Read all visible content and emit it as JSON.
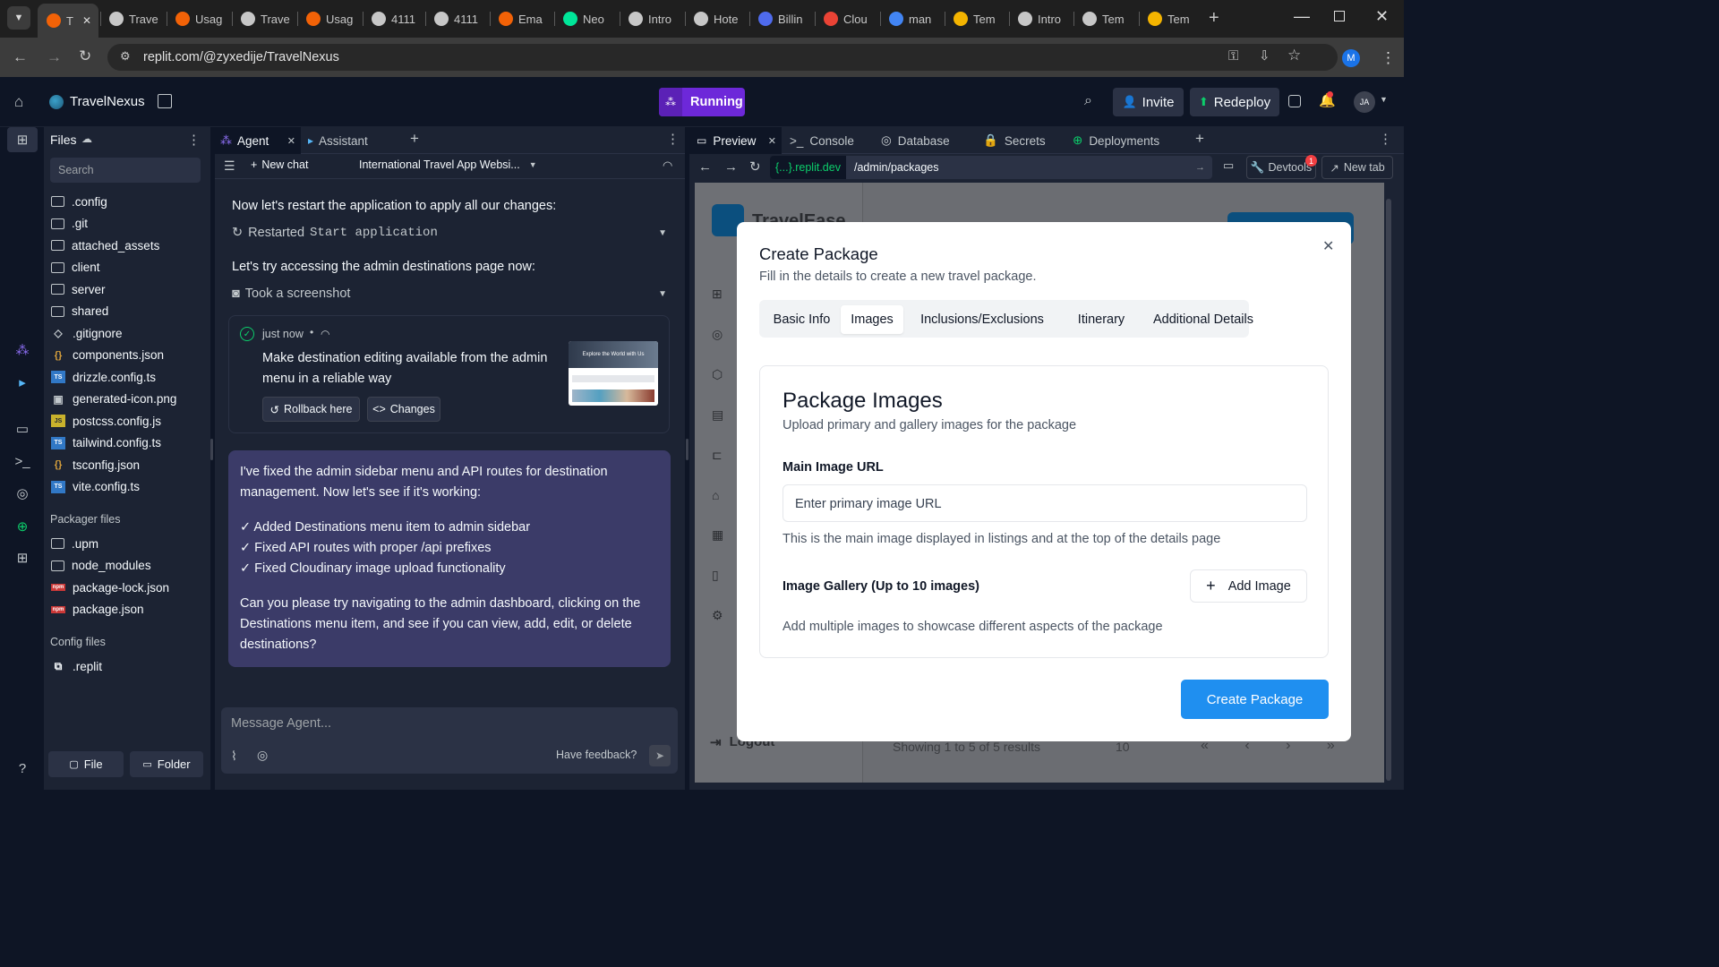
{
  "browser": {
    "tabs": [
      {
        "label": "T",
        "icon": "replit-icon",
        "color": "#f26207"
      },
      {
        "label": "Trave",
        "icon": "globe-icon",
        "color": "#c7c7c7"
      },
      {
        "label": "Usag",
        "icon": "replit-icon",
        "color": "#f26207"
      },
      {
        "label": "Trave",
        "icon": "globe-icon",
        "color": "#c7c7c7"
      },
      {
        "label": "Usag",
        "icon": "replit-icon",
        "color": "#f26207"
      },
      {
        "label": "4111",
        "icon": "globe-icon",
        "color": "#c7c7c7"
      },
      {
        "label": "4111",
        "icon": "globe-icon",
        "color": "#c7c7c7"
      },
      {
        "label": "Ema",
        "icon": "replit-icon",
        "color": "#f26207"
      },
      {
        "label": "Neo",
        "icon": "neon-icon",
        "color": "#00e699"
      },
      {
        "label": "Intro",
        "icon": "openai-icon",
        "color": "#c7c7c7"
      },
      {
        "label": "Hote",
        "icon": "openai-icon",
        "color": "#c7c7c7"
      },
      {
        "label": "Billin",
        "icon": "billing-icon",
        "color": "#4f6bed"
      },
      {
        "label": "Clou",
        "icon": "gmail-icon",
        "color": "#ea4335"
      },
      {
        "label": "man",
        "icon": "google-icon",
        "color": "#4285f4"
      },
      {
        "label": "Tem",
        "icon": "envelope-icon",
        "color": "#f4b400"
      },
      {
        "label": "Intro",
        "icon": "openai-icon",
        "color": "#c7c7c7"
      },
      {
        "label": "Tem",
        "icon": "openai-icon",
        "color": "#c7c7c7"
      },
      {
        "label": "Tem",
        "icon": "envelope-icon",
        "color": "#f4b400"
      }
    ],
    "url": "replit.com/@zyxedije/TravelNexus",
    "profile_initial": "M"
  },
  "replit": {
    "project_name": "TravelNexus",
    "run_status": "Running",
    "invite_label": "Invite",
    "redeploy_label": "Redeploy",
    "avatar_initials": "JA"
  },
  "files": {
    "title": "Files",
    "search_placeholder": "Search",
    "items": [
      {
        "name": ".config",
        "type": "folder"
      },
      {
        "name": ".git",
        "type": "folder"
      },
      {
        "name": "attached_assets",
        "type": "folder"
      },
      {
        "name": "client",
        "type": "folder"
      },
      {
        "name": "server",
        "type": "folder"
      },
      {
        "name": "shared",
        "type": "folder"
      },
      {
        "name": ".gitignore",
        "type": "git"
      },
      {
        "name": "components.json",
        "type": "json"
      },
      {
        "name": "drizzle.config.ts",
        "type": "ts"
      },
      {
        "name": "generated-icon.png",
        "type": "image"
      },
      {
        "name": "postcss.config.js",
        "type": "js"
      },
      {
        "name": "tailwind.config.ts",
        "type": "ts"
      },
      {
        "name": "tsconfig.json",
        "type": "json"
      },
      {
        "name": "vite.config.ts",
        "type": "ts"
      }
    ],
    "packager_title": "Packager files",
    "packager_items": [
      {
        "name": ".upm",
        "type": "folder"
      },
      {
        "name": "node_modules",
        "type": "folder"
      },
      {
        "name": "package-lock.json",
        "type": "npm"
      },
      {
        "name": "package.json",
        "type": "npm"
      }
    ],
    "config_title": "Config files",
    "config_items": [
      {
        "name": ".replit",
        "type": "replit"
      }
    ],
    "file_button": "File",
    "folder_button": "Folder"
  },
  "agent": {
    "tabs": [
      {
        "label": "Agent"
      },
      {
        "label": "Assistant"
      }
    ],
    "new_chat": "New chat",
    "chat_title": "International Travel App Websi...",
    "msg_restart": "Now let's restart the application to apply all our changes:",
    "restarted_label": "Restarted",
    "restarted_code": "Start application",
    "msg_access": "Let's try accessing the admin destinations page now:",
    "screenshot_label": "Took a screenshot",
    "checkpoint": {
      "time": "just now",
      "text": "Make destination editing available from the admin menu in a reliable way",
      "rollback": "Rollback here",
      "changes": "Changes",
      "thumb_text": "Explore the World with Us"
    },
    "reply": {
      "intro": "I've fixed the admin sidebar menu and API routes for destination management. Now let's see if it's working:",
      "bullets": [
        "✓ Added Destinations menu item to admin sidebar",
        "✓ Fixed API routes with proper /api prefixes",
        "✓ Fixed Cloudinary image upload functionality"
      ],
      "outro": "Can you please try navigating to the admin dashboard, clicking on the Destinations menu item, and see if you can view, add, edit, or delete destinations?"
    },
    "input_placeholder": "Message Agent...",
    "feedback": "Have feedback?"
  },
  "preview": {
    "tabs": [
      {
        "label": "Preview"
      },
      {
        "label": "Console"
      },
      {
        "label": "Database"
      },
      {
        "label": "Secrets"
      },
      {
        "label": "Deployments"
      }
    ],
    "domain": "{...}.replit.dev",
    "path": "/admin/packages",
    "devtools": "Devtools",
    "devtools_badge": "1",
    "new_tab": "New tab",
    "bg_logo": "TravelEase",
    "bg_logout": "Logout",
    "bg_showing": "Showing 1 to 5 of 5 results",
    "bg_per_page": "10",
    "bg_pager": "«  ‹  ›  »"
  },
  "modal": {
    "title": "Create Package",
    "subtitle": "Fill in the details to create a new travel package.",
    "tabs": [
      {
        "label": "Basic Info"
      },
      {
        "label": "Images"
      },
      {
        "label": "Inclusions/Exclusions"
      },
      {
        "label": "Itinerary"
      },
      {
        "label": "Additional Details"
      }
    ],
    "selected_tab": "Images",
    "section_title": "Package Images",
    "section_subtitle": "Upload primary and gallery images for the package",
    "main_label": "Main Image URL",
    "main_placeholder": "Enter primary image URL",
    "main_help": "This is the main image displayed in listings and at the top of the details page",
    "gallery_label": "Image Gallery (Up to 10 images)",
    "add_image": "Add Image",
    "gallery_help": "Add multiple images to showcase different aspects of the package",
    "submit": "Create Package"
  },
  "colors": {
    "replit_bg": "#0e1525",
    "panel_bg": "#1c2333",
    "running": "#7c3aed",
    "primary_button": "#1f8ff0"
  }
}
